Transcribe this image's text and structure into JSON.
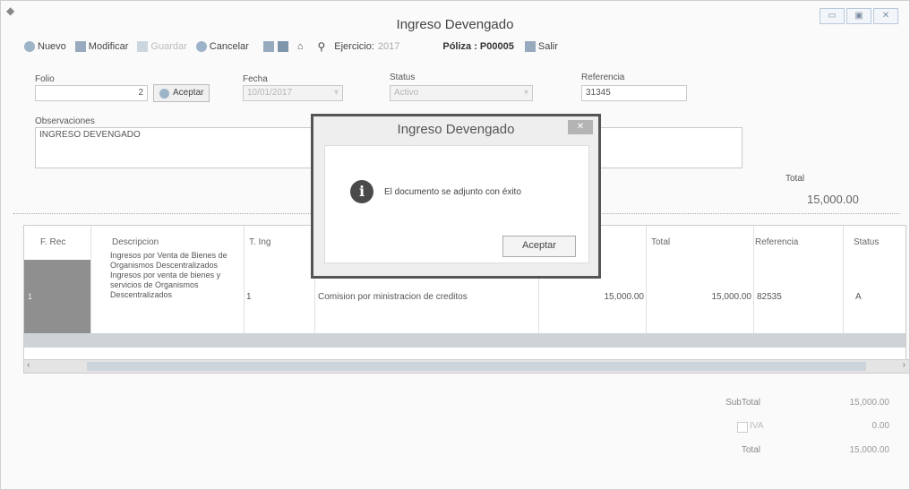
{
  "window": {
    "title": "Ingreso Devengado",
    "controls": [
      "▭",
      "▣",
      "✕"
    ]
  },
  "toolbar": {
    "nuevo": "Nuevo",
    "modificar": "Modificar",
    "guardar": "Guardar",
    "cancelar": "Cancelar",
    "ejercicio_label": "Ejercicio:",
    "ejercicio_value": "2017",
    "poliza": "Póliza : P00005",
    "salir": "Salir"
  },
  "form": {
    "folio_label": "Folio",
    "folio_value": "2",
    "aceptar_label": "Aceptar",
    "fecha_label": "Fecha",
    "fecha_value": "10/01/2017",
    "status_label": "Status",
    "status_value": "Activo",
    "referencia_label": "Referencia",
    "referencia_value": "31345",
    "observaciones_label": "Observaciones",
    "observaciones_value": "INGRESO DEVENGADO",
    "total_label": "Total",
    "total_value": "15,000.00"
  },
  "grid": {
    "headers": [
      "F. Rec",
      "Descripcion",
      "T. Ing",
      "",
      "",
      "Total",
      "Referencia",
      "Status"
    ],
    "row": {
      "frec": "1",
      "descripcion": "Ingresos por Venta de Bienes de Organismos Descentralizados Ingresos por venta de bienes y servicios de Organismos Descentralizados",
      "tipo": "1",
      "concepto": "Comision por ministracion de creditos",
      "importe": "15,000.00",
      "total": "15,000.00",
      "referencia": "82535",
      "status": "A"
    }
  },
  "totals": {
    "subtotal_label": "SubTotal",
    "subtotal_value": "15,000.00",
    "iva_label": "IVA",
    "iva_value": "0.00",
    "total_label": "Total",
    "total_value": "15,000.00"
  },
  "dialog": {
    "title": "Ingreso Devengado",
    "close": "✕",
    "message": "El documento se adjunto con éxito",
    "ok_label": "Aceptar"
  }
}
